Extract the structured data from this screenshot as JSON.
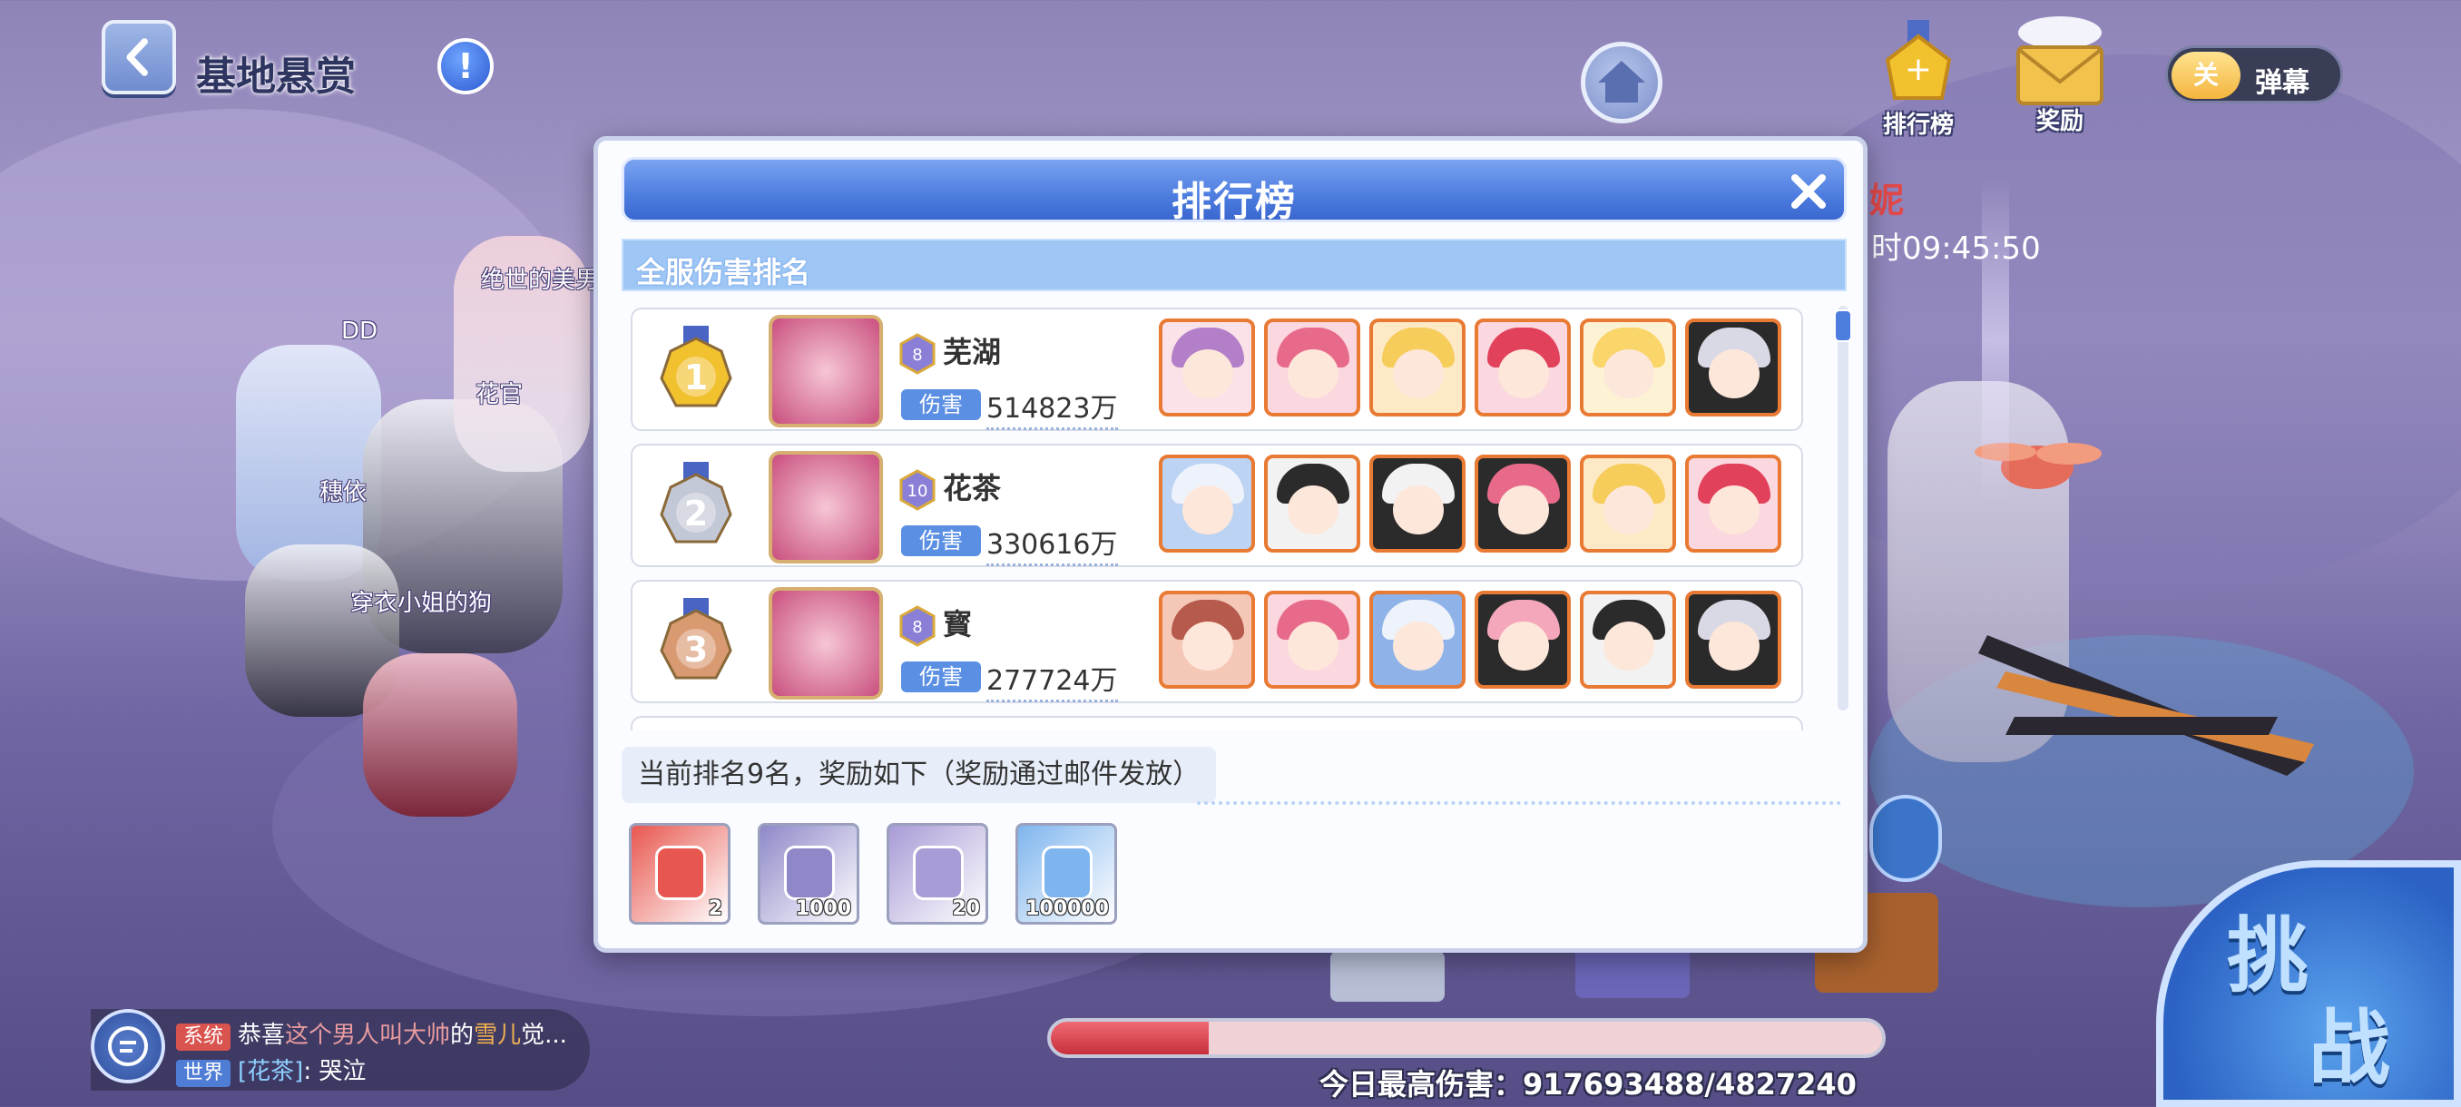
{
  "header": {
    "title": "基地悬赏",
    "info_glyph": "!",
    "icons": {
      "back": "chevron-left-icon",
      "home": "home-icon"
    }
  },
  "top_right": {
    "leaderboard_label": "排行榜",
    "reward_label": "奖励",
    "barrage_toggle": {
      "state_label": "关",
      "label": "弹幕"
    }
  },
  "field_labels": [
    "绝世的美男",
    "DD",
    "花官",
    "穗依",
    "穿衣小姐的狗"
  ],
  "boss": {
    "name_fragment": "妮",
    "time": "时09:45:50"
  },
  "modal": {
    "title": "排行榜",
    "section": "全服伤害排名",
    "damage_tag": "伤害",
    "rows": [
      {
        "rank": 1,
        "medal_color": "#f2c12e",
        "level": "8",
        "name": "芜湖",
        "damage": "514823万",
        "team": [
          [
            "#b37fc9",
            "#fbe2e8"
          ],
          [
            "#e86a8a",
            "#fbd7e0"
          ],
          [
            "#f6cc5b",
            "#fde9c5"
          ],
          [
            "#e2415c",
            "#fbd7e0"
          ],
          [
            "#f9d56a",
            "#fdf2d4"
          ],
          [
            "#d9d9e6",
            "#2a2a2a"
          ]
        ]
      },
      {
        "rank": 2,
        "medal_color": "#c3c8d6",
        "level": "10",
        "name": "花茶",
        "damage": "330616万",
        "team": [
          [
            "#eef2fb",
            "#bcd3f4"
          ],
          [
            "#2b2b2b",
            "#f2f2f2"
          ],
          [
            "#f2f2f2",
            "#2b2b2b"
          ],
          [
            "#e86a8a",
            "#2b2b2b"
          ],
          [
            "#f6cc5b",
            "#fde9c5"
          ],
          [
            "#e2415c",
            "#fbd7e0"
          ]
        ]
      },
      {
        "rank": 3,
        "medal_color": "#d99a72",
        "level": "8",
        "name": "寳",
        "damage": "277724万",
        "team": [
          [
            "#b55a4c",
            "#f5c7b7"
          ],
          [
            "#e86a8a",
            "#fbd7e0"
          ],
          [
            "#eef2fb",
            "#8fb3e8"
          ],
          [
            "#f4a7bb",
            "#2b2b2b"
          ],
          [
            "#2b2b2b",
            "#f2f2f2"
          ],
          [
            "#d9d9e6",
            "#2a2a2a"
          ]
        ]
      }
    ],
    "rank_note": "当前排名9名，奖励如下（奖励通过邮件发放）",
    "rewards": [
      {
        "icon": "red-card-icon",
        "qty": "2",
        "color": "#e8574f"
      },
      {
        "icon": "gear-token-icon",
        "qty": "1000",
        "color": "#8e88c9"
      },
      {
        "icon": "crystal-icon",
        "qty": "20",
        "color": "#a89bd6"
      },
      {
        "icon": "gold-coin-icon",
        "qty": "100000",
        "color": "#7fb5ee"
      }
    ]
  },
  "challenge_label": [
    "挑",
    "战"
  ],
  "best_damage": "今日最高伤害：917693488/4827240",
  "boss_hp_fraction": 0.19,
  "chat": {
    "line1": {
      "tag": "系统",
      "text_pre": "恭喜",
      "name": "这个男人叫大帅",
      "mid": "的",
      "item": "雪儿",
      "text_post": "觉..."
    },
    "line2": {
      "tag": "世界",
      "speaker": "[花茶]",
      "sep": ": ",
      "msg": "哭泣"
    }
  }
}
